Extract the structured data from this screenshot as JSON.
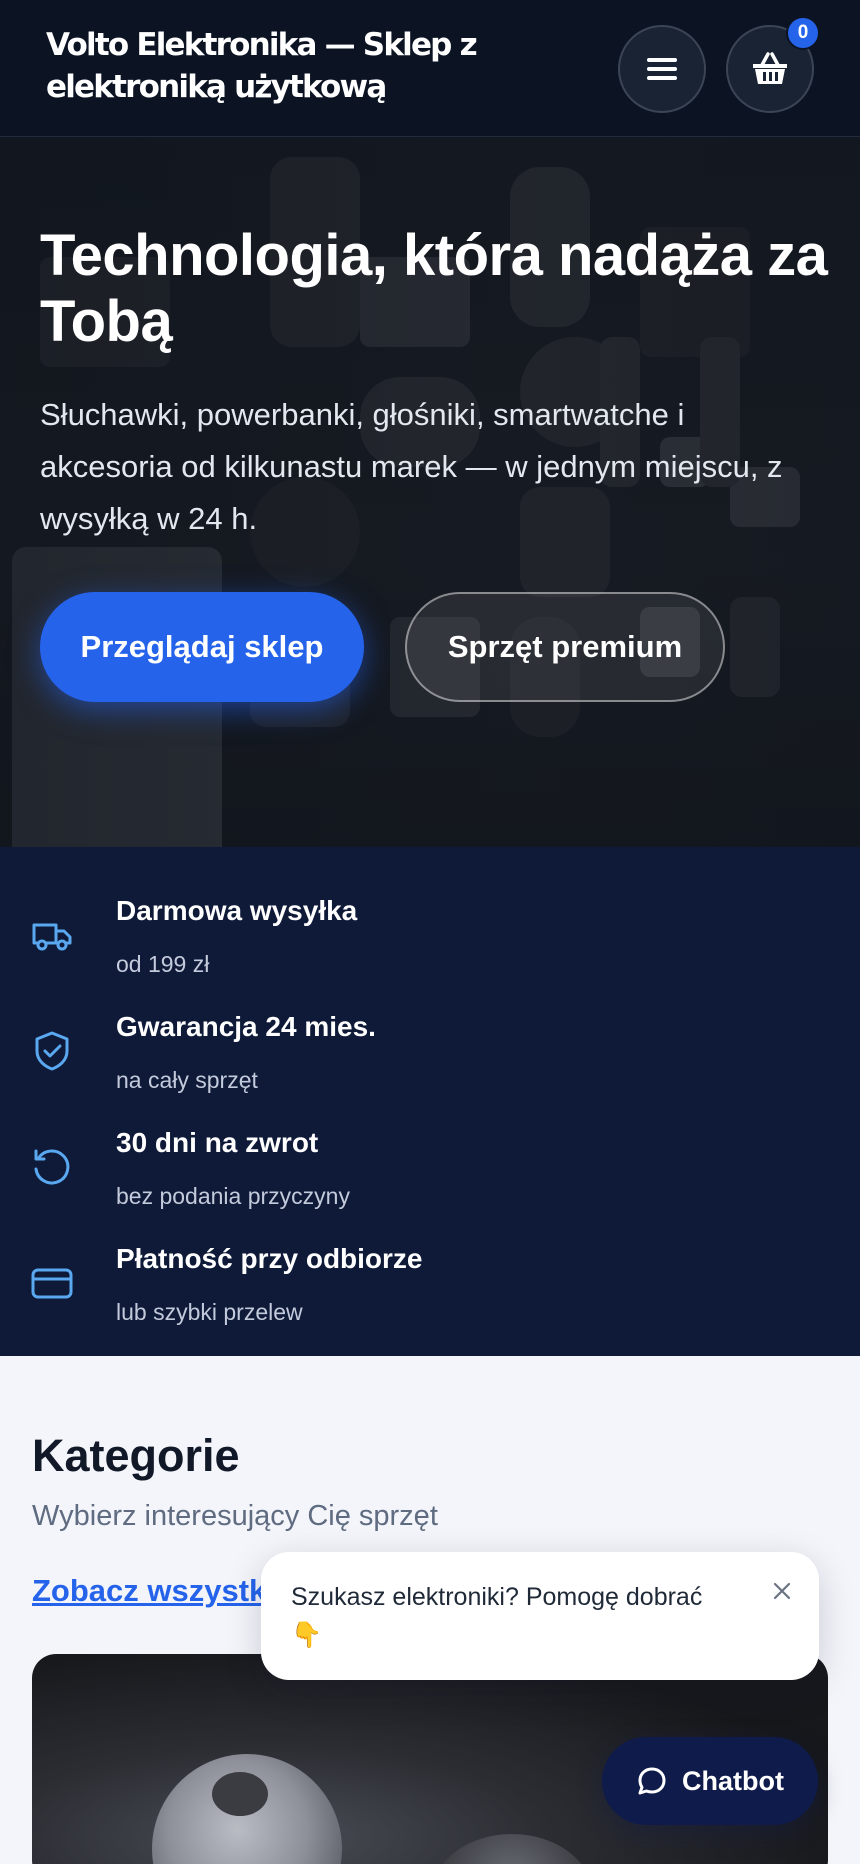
{
  "header": {
    "brand": "Volto Elektronika — Sklep z elektroniką użytkową",
    "menu_icon": "hamburger-menu-icon",
    "cart_icon": "basket-icon",
    "cart_count": "0"
  },
  "hero": {
    "title": "Technologia, która nadąża za Tobą",
    "subtitle": "Słuchawki, powerbanki, głośniki, smartwatche i akcesoria od kilkunastu marek — w jednym miejscu, z wysyłką w 24 h.",
    "primary_button": "Przeglądaj sklep",
    "secondary_button": "Sprzęt premium"
  },
  "features": [
    {
      "icon": "truck-icon",
      "title": "Darmowa wysyłka",
      "subtitle": "od 199 zł"
    },
    {
      "icon": "shield-check-icon",
      "title": "Gwarancja 24 mies.",
      "subtitle": "na cały sprzęt"
    },
    {
      "icon": "rotate-ccw-icon",
      "title": "30 dni na zwrot",
      "subtitle": "bez podania przyczyny"
    },
    {
      "icon": "credit-card-icon",
      "title": "Płatność przy odbiorze",
      "subtitle": "lub szybki przelew"
    }
  ],
  "categories": {
    "title": "Kategorie",
    "subtitle": "Wybierz interesujący Cię sprzęt",
    "link": "Zobacz wszystkie"
  },
  "chat": {
    "popup_text": "Szukasz elektroniki? Pomogę dobrać 👇",
    "button_label": "Chatbot",
    "button_icon": "chat-bubble-icon",
    "close_icon": "close-icon"
  },
  "colors": {
    "accent": "#2563eb",
    "header_bg": "#0c1424",
    "features_bg": "#0e1a38",
    "feature_icon": "#5aa8f0",
    "page_bg": "#f3f5fa"
  }
}
